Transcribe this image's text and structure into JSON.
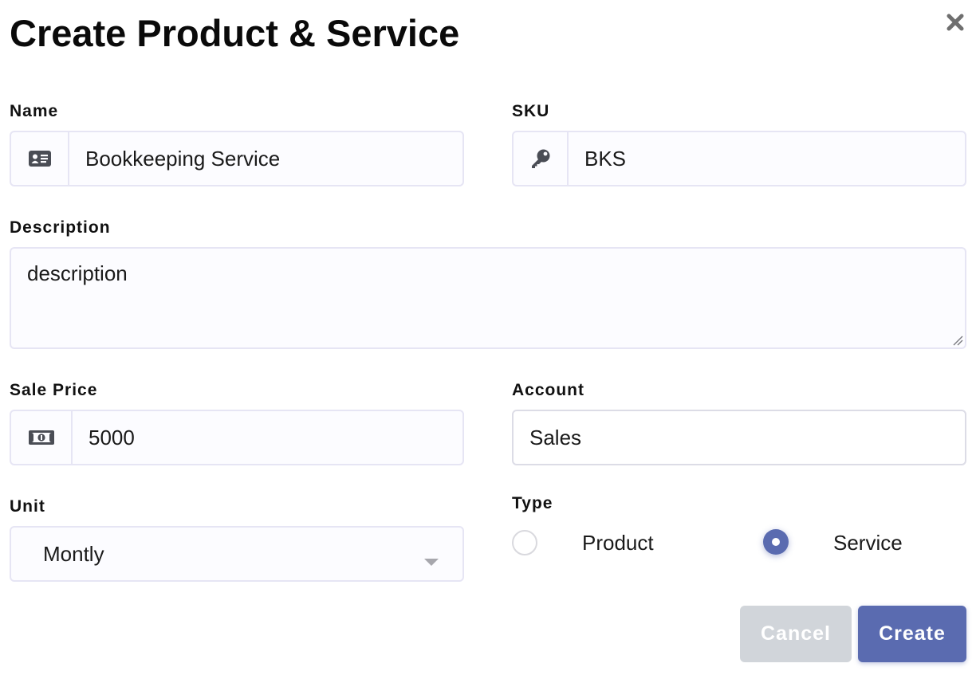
{
  "dialog": {
    "title": "Create Product & Service",
    "close_icon": "close-icon"
  },
  "fields": {
    "name": {
      "label": "Name",
      "value": "Bookkeeping Service",
      "icon": "id-card-icon"
    },
    "sku": {
      "label": "SKU",
      "value": "BKS",
      "icon": "key-icon"
    },
    "description": {
      "label": "Description",
      "value": "description"
    },
    "sale_price": {
      "label": "Sale Price",
      "value": "5000",
      "icon": "money-bill-icon"
    },
    "account": {
      "label": "Account",
      "value": "Sales"
    },
    "unit": {
      "label": "Unit",
      "value": "Montly"
    },
    "type": {
      "label": "Type",
      "options": [
        "Product",
        "Service"
      ],
      "selected": "Service"
    }
  },
  "actions": {
    "cancel_label": "Cancel",
    "create_label": "Create"
  },
  "colors": {
    "accent": "#5a6bb0",
    "cancel_bg": "#d1d5da",
    "field_border": "#e6e5f4",
    "field_bg": "#fcfcff"
  }
}
